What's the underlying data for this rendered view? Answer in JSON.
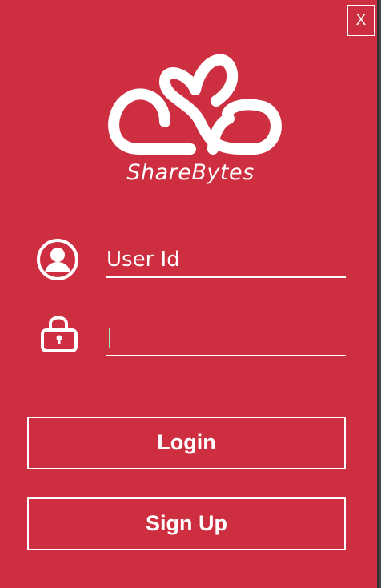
{
  "window": {
    "close_label": "X",
    "background_color": "#cd2f41"
  },
  "brand": {
    "name": "ShareBytes",
    "logo_icon": "cloud-logo-icon"
  },
  "form": {
    "userid": {
      "icon": "user-avatar-icon",
      "placeholder": "User Id",
      "value": ""
    },
    "password": {
      "icon": "lock-icon",
      "placeholder": "",
      "value": ""
    }
  },
  "actions": {
    "login_label": "Login",
    "signup_label": "Sign Up"
  }
}
